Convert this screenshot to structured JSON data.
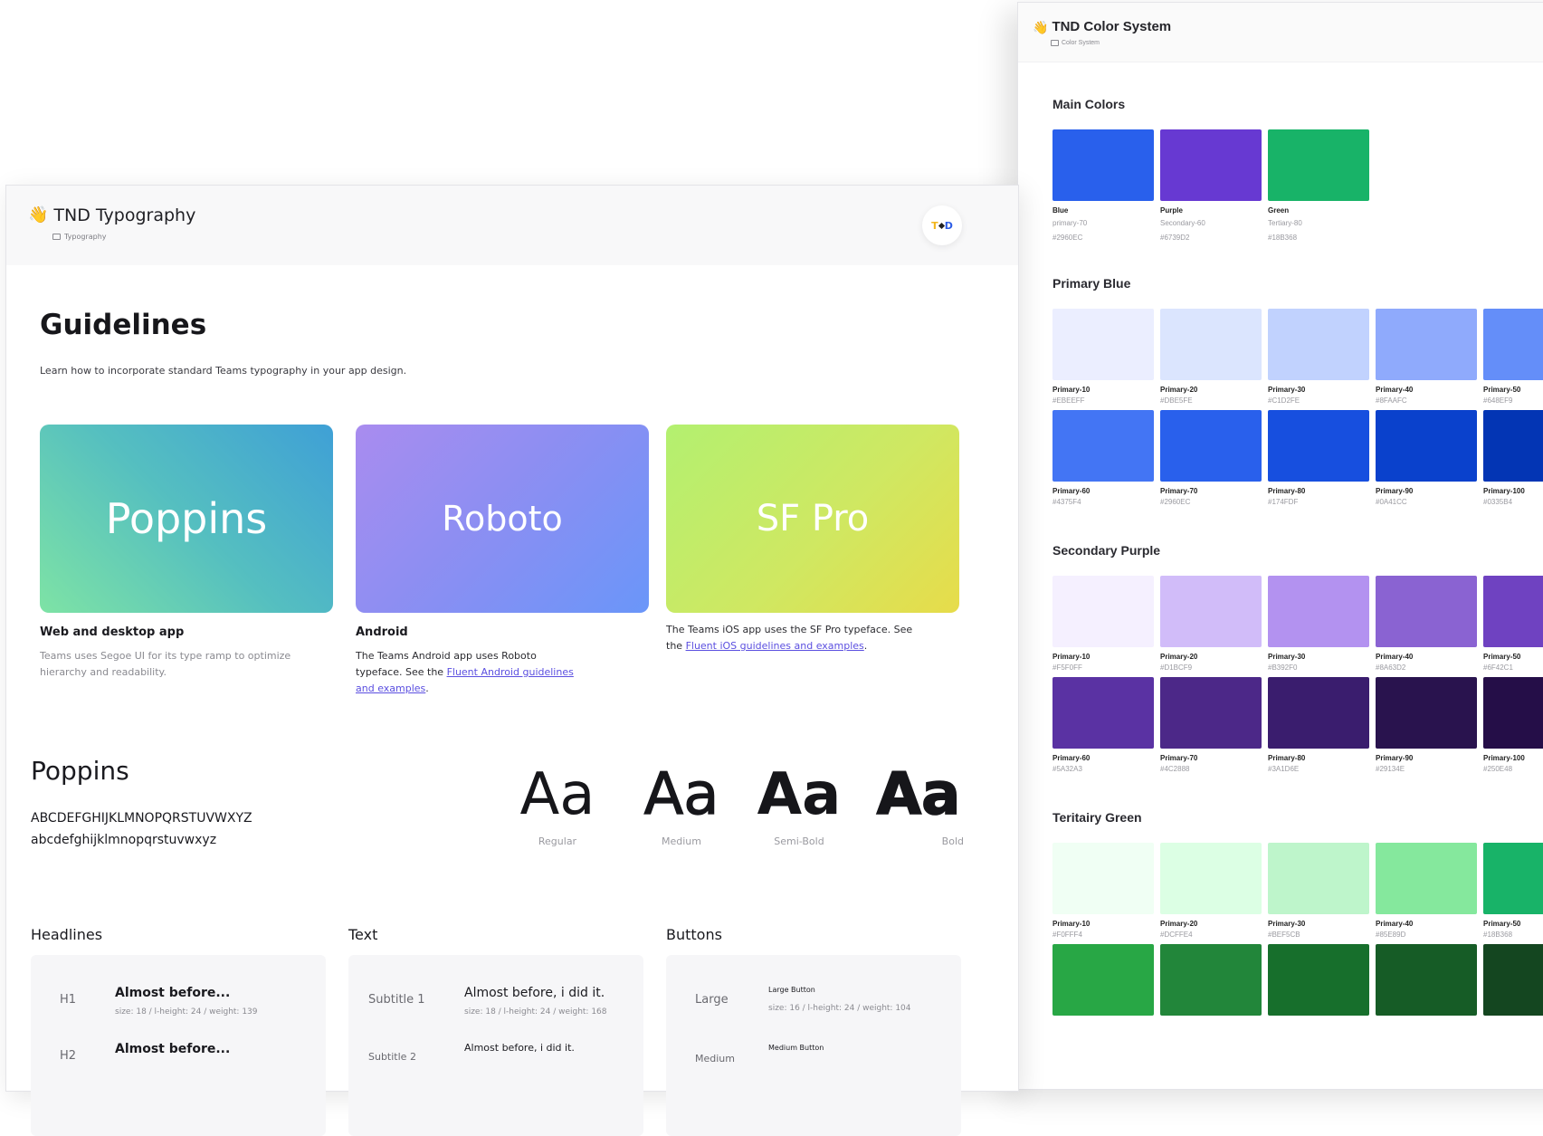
{
  "color_system": {
    "header": {
      "title": "TND Color System",
      "breadcrumb": "Color System"
    },
    "main_colors": {
      "title": "Main Colors",
      "items": [
        {
          "name": "Blue",
          "alias": "primary-70",
          "hex": "#2960EC",
          "color": "#2960EC"
        },
        {
          "name": "Purple",
          "alias": "Secondary-60",
          "hex": "#6739D2",
          "color": "#6739D2"
        },
        {
          "name": "Green",
          "alias": "Tertiary-80",
          "hex": "#18B368",
          "color": "#18B368"
        }
      ]
    },
    "primary_blue": {
      "title": "Primary Blue",
      "row1": [
        {
          "name": "Primary-10",
          "hex": "#EBEEFF",
          "color": "#EBEEFF"
        },
        {
          "name": "Primary-20",
          "hex": "#DBE5FE",
          "color": "#DBE5FE"
        },
        {
          "name": "Primary-30",
          "hex": "#C1D2FE",
          "color": "#C1D2FE"
        },
        {
          "name": "Primary-40",
          "hex": "#8FAAFC",
          "color": "#8FAAFC"
        },
        {
          "name": "Primary-50",
          "hex": "#648EF9",
          "color": "#648EF9"
        }
      ],
      "row2": [
        {
          "name": "Primary-60",
          "hex": "#4375F4",
          "color": "#4375F4"
        },
        {
          "name": "Primary-70",
          "hex": "#2960EC",
          "color": "#2960EC"
        },
        {
          "name": "Primary-80",
          "hex": "#174FDF",
          "color": "#174FDF"
        },
        {
          "name": "Primary-90",
          "hex": "#0A41CC",
          "color": "#0A41CC"
        },
        {
          "name": "Primary-100",
          "hex": "#0335B4",
          "color": "#0335B4"
        }
      ]
    },
    "secondary_purple": {
      "title": "Secondary Purple",
      "row1": [
        {
          "name": "Primary-10",
          "hex": "#F5F0FF",
          "color": "#F5F0FF"
        },
        {
          "name": "Primary-20",
          "hex": "#D1BCF9",
          "color": "#D1BCF9"
        },
        {
          "name": "Primary-30",
          "hex": "#B392F0",
          "color": "#B392F0"
        },
        {
          "name": "Primary-40",
          "hex": "#8A63D2",
          "color": "#8A63D2"
        },
        {
          "name": "Primary-50",
          "hex": "#6F42C1",
          "color": "#6F42C1"
        }
      ],
      "row2": [
        {
          "name": "Primary-60",
          "hex": "#5A32A3",
          "color": "#5A32A3"
        },
        {
          "name": "Primary-70",
          "hex": "#4C2888",
          "color": "#4C2888"
        },
        {
          "name": "Primary-80",
          "hex": "#3A1D6E",
          "color": "#3A1D6E"
        },
        {
          "name": "Primary-90",
          "hex": "#29134E",
          "color": "#29134E"
        },
        {
          "name": "Primary-100",
          "hex": "#250E48",
          "color": "#250E48"
        }
      ]
    },
    "tertiary_green": {
      "title": "Teritairy Green",
      "row1": [
        {
          "name": "Primary-10",
          "hex": "#F0FFF4",
          "color": "#F0FFF4"
        },
        {
          "name": "Primary-20",
          "hex": "#DCFFE4",
          "color": "#DCFFE4"
        },
        {
          "name": "Primary-30",
          "hex": "#BEF5CB",
          "color": "#BEF5CB"
        },
        {
          "name": "Primary-40",
          "hex": "#85E89D",
          "color": "#85E89D"
        },
        {
          "name": "Primary-50",
          "hex": "#18B368",
          "color": "#18B368"
        }
      ],
      "row2_colors": [
        "#28A745",
        "#22863A",
        "#176F2C",
        "#165C26",
        "#144620"
      ]
    }
  },
  "typography": {
    "header": {
      "title": "TND Typography",
      "breadcrumb": "Typography",
      "logo_t": "T",
      "logo_d": "D"
    },
    "guidelines": {
      "title": "Guidelines",
      "description": "Learn how to incorporate standard Teams typography in your app design."
    },
    "fonts": [
      {
        "name": "Poppins",
        "label": "Web and desktop app",
        "desc": "Teams uses Segoe UI for its type ramp to optimize hierarchy and readability."
      },
      {
        "name": "Roboto",
        "label": "Android",
        "desc_pre": "The Teams Android app uses Roboto typeface. See the ",
        "link": "Fluent Android guidelines and examples",
        "desc_post": "."
      },
      {
        "name": "SF Pro",
        "desc_pre": "The Teams iOS app uses the SF Pro typeface. See the ",
        "link": "Fluent iOS guidelines and examples",
        "desc_post": "."
      }
    ],
    "poppins": {
      "title": "Poppins",
      "uppercase": "ABCDEFGHIJKLMNOPQRSTUVWXYZ",
      "lowercase": "abcdefghijklmnopqrstuvwxyz",
      "weights": [
        {
          "sample": "Aa",
          "label": "Regular"
        },
        {
          "sample": "Aa",
          "label": "Medium"
        },
        {
          "sample": "Aa",
          "label": "Semi-Bold"
        },
        {
          "sample": "Aa",
          "label": "Bold"
        }
      ]
    },
    "headlines": {
      "title": "Headlines",
      "rows": [
        {
          "key": "H1",
          "sample": "Almost before...",
          "meta": "size: 18 / l-height: 24 / weight: 139"
        },
        {
          "key": "H2",
          "sample": "Almost before..."
        }
      ]
    },
    "text": {
      "title": "Text",
      "rows": [
        {
          "key": "Subtitle 1",
          "sample": "Almost before, i did it.",
          "meta": "size: 18 / l-height: 24 / weight: 168"
        },
        {
          "key": "Subtitle 2",
          "sample": "Almost before, i did it."
        }
      ]
    },
    "buttons": {
      "title": "Buttons",
      "rows": [
        {
          "key": "Large",
          "sample": "Large Button",
          "meta": "size: 16 / l-height: 24 / weight: 104"
        },
        {
          "key": "Medium",
          "sample": "Medium Button"
        }
      ]
    }
  }
}
